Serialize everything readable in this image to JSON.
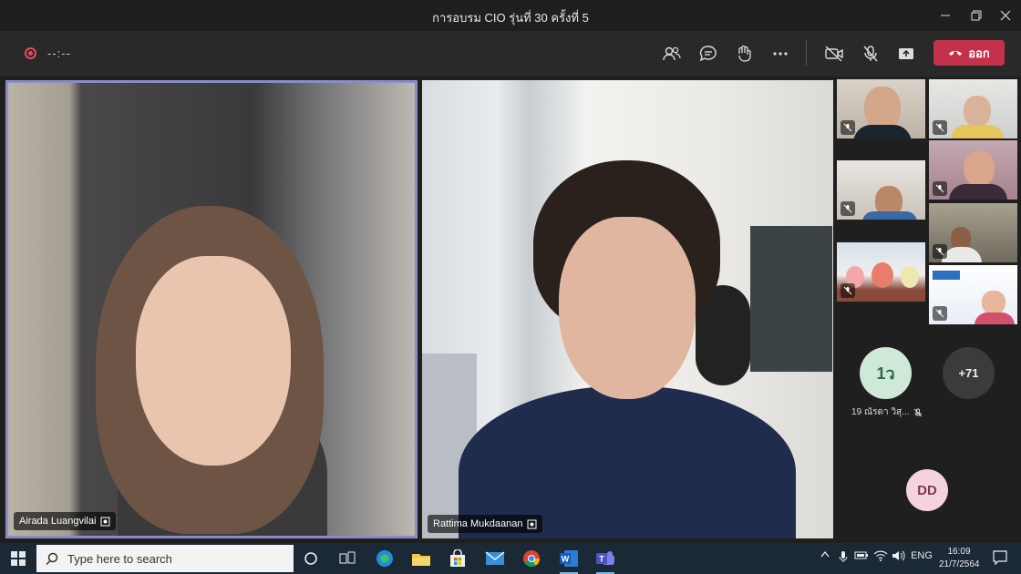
{
  "window": {
    "title": "การอบรม CIO รุ่นที่ 30 ครั้งที่ 5"
  },
  "toolbar": {
    "timer": "--:--",
    "leave_label": "ออก",
    "icons": [
      "record-icon",
      "participants-icon",
      "chat-icon",
      "reactions-icon",
      "more-icon",
      "camera-off-icon",
      "mic-off-icon",
      "share-screen-icon",
      "phone-hangup-icon"
    ],
    "leave_color": "#c4314b"
  },
  "stage": {
    "tiles": [
      {
        "name": "Airada Luangvilai",
        "pinned": true
      },
      {
        "name": "Rattima Mukdaanan"
      }
    ],
    "gallery": [
      {
        "muted": true
      },
      {
        "muted": true
      },
      {
        "muted": true
      },
      {
        "muted": true
      },
      {
        "muted": true
      },
      {
        "muted": true
      },
      {
        "muted": true
      },
      {
        "muted": true
      }
    ],
    "avatar_1_initials": "1ว",
    "avatar_1_label": "19 ณัรดา วิสุ...",
    "more_count": "+71",
    "avatar_2_initials": "DD",
    "active_speaker_color": "#8b8cc7"
  },
  "taskbar": {
    "search_placeholder": "Type here to search",
    "language": "ENG",
    "time": "16:09",
    "date": "21/7/2564",
    "apps": [
      "cortana-icon",
      "task-view-icon",
      "edge-icon",
      "file-explorer-icon",
      "store-icon",
      "mail-icon",
      "chrome-icon",
      "word-icon",
      "teams-icon"
    ]
  }
}
